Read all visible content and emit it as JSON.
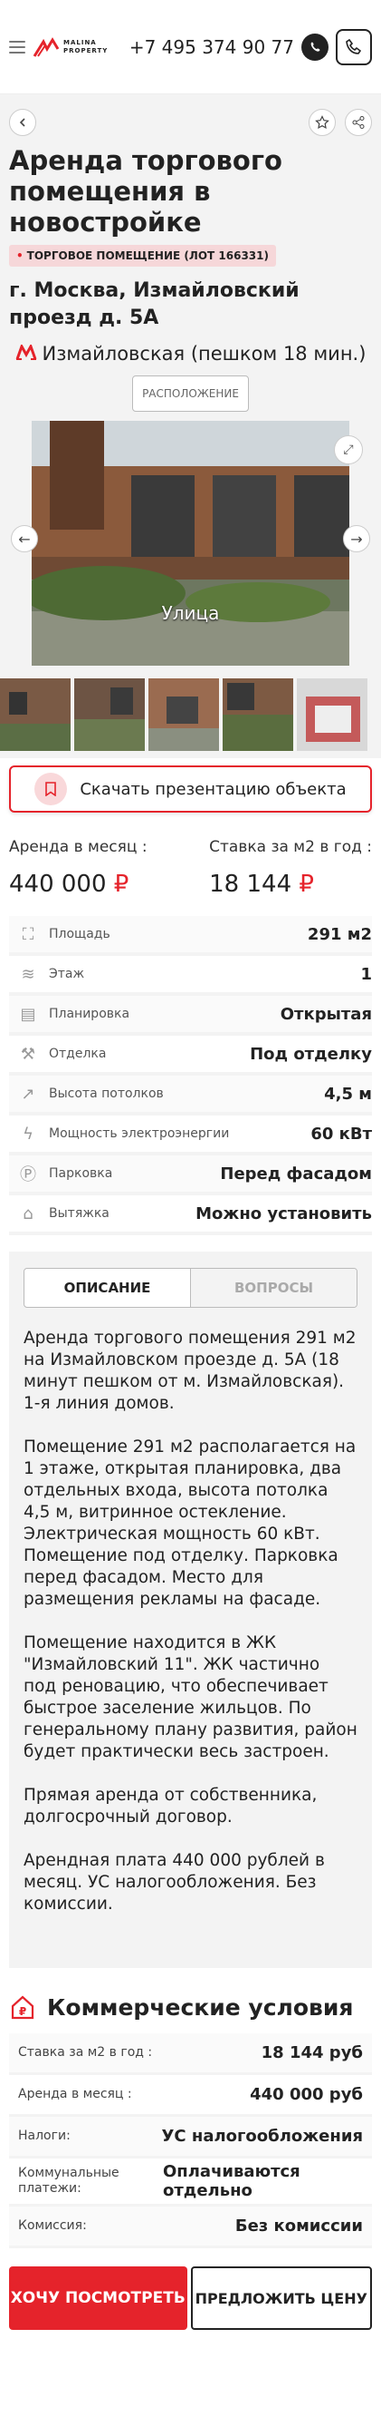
{
  "header": {
    "logo_line1": "MALINA",
    "logo_line2": "PROPERTY",
    "phone": "+7 495 374 90 77"
  },
  "listing": {
    "title": "Аренда торгового помещения в новостройке",
    "tag": "ТОРГОВОЕ ПОМЕЩЕНИЕ (ЛОТ 166331)",
    "address": "г. Москва, Измайловский проезд д. 5А",
    "metro": "Измайловская (пешком 18 мин.)",
    "location_button": "РАСПОЛОЖЕНИЕ",
    "photo_caption": "Улица"
  },
  "download_button": "Скачать презентацию объекта",
  "prices": {
    "monthly_label": "Аренда в месяц :",
    "monthly_value": "440 000",
    "rate_label": "Ставка за м2 в год :",
    "rate_value": "18 144",
    "currency": "₽"
  },
  "params": [
    {
      "icon": "area-icon",
      "glyph": "⛶",
      "label": "Площадь",
      "value": "291 м2"
    },
    {
      "icon": "floor-icon",
      "glyph": "≋",
      "label": "Этаж",
      "value": "1"
    },
    {
      "icon": "layout-icon",
      "glyph": "▤",
      "label": "Планировка",
      "value": "Открытая"
    },
    {
      "icon": "finishing-icon",
      "glyph": "⚒",
      "label": "Отделка",
      "value": "Под отделку"
    },
    {
      "icon": "ceiling-height-icon",
      "glyph": "↗",
      "label": "Высота потолков",
      "value": "4,5 м"
    },
    {
      "icon": "power-icon",
      "glyph": "ϟ",
      "label": "Мощность электроэнергии",
      "value": "60 кВт"
    },
    {
      "icon": "parking-icon",
      "glyph": "Ⓟ",
      "label": "Парковка",
      "value": "Перед фасадом"
    },
    {
      "icon": "hood-icon",
      "glyph": "⌂",
      "label": "Вытяжка",
      "value": "Можно установить"
    }
  ],
  "tabs": {
    "description": "ОПИСАНИЕ",
    "questions": "ВОПРОСЫ"
  },
  "description": [
    "Аренда торгового помещения 291 м2 на Измайловском проезде д. 5А (18 минут пешком от м. Измайловская). 1-я линия домов.",
    "Помещение 291 м2 располагается на 1 этаже, открытая планировка, два отдельных входа, высота потолка 4,5 м, витринное остекление. Электрическая мощность 60 кВт. Помещение под отделку. Парковка перед фасадом. Место для размещения рекламы на фасаде.",
    "Помещение находится в ЖК \"Измайловский 11\". ЖК частично под реновацию, что обеспечивает быстрое заселение жильцов. По генеральному плану развития, район будет практически весь застроен.",
    "Прямая аренда от собственника, долгосрочный договор.",
    "Арендная плата 440 000 рублей в месяц. УС налогообложения. Без комиссии."
  ],
  "commercial": {
    "title": "Коммерческие условия",
    "rows": [
      {
        "label": "Ставка за м2 в год :",
        "value": "18 144 руб"
      },
      {
        "label": "Аренда в месяц :",
        "value": "440 000 руб"
      },
      {
        "label": "Налоги:",
        "value": "УС налогообложения"
      },
      {
        "label": "Коммунальные платежи:",
        "value": "Оплачиваются отдельно"
      },
      {
        "label": "Комиссия:",
        "value": "Без комиссии"
      }
    ]
  },
  "actions": {
    "view": "ХОЧУ ПОСМОТРЕТЬ",
    "offer": "ПРЕДЛОЖИТЬ ЦЕНУ"
  },
  "colors": {
    "accent": "#e5232b",
    "background_panel": "#f3f3f3"
  }
}
